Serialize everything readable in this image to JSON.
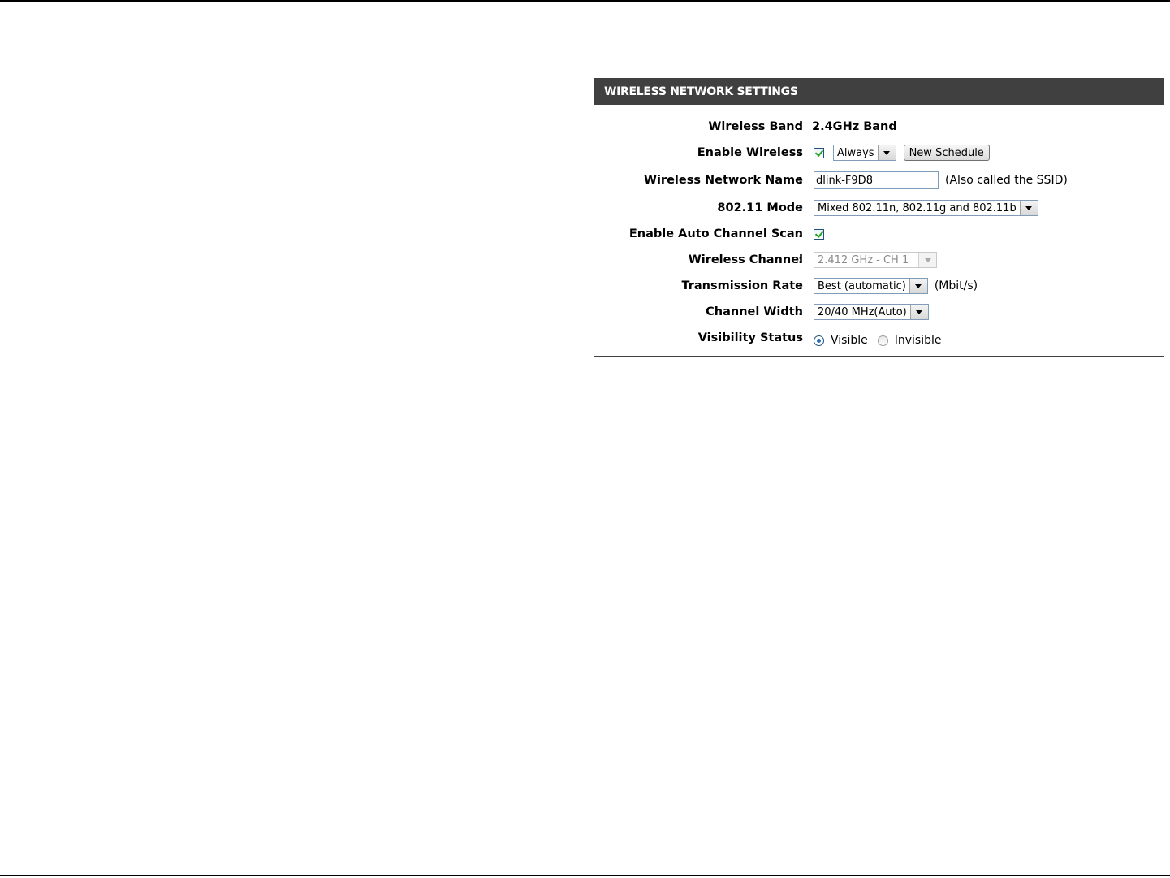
{
  "panel": {
    "title": "WIRELESS NETWORK SETTINGS"
  },
  "rows": {
    "wireless_band": {
      "label": "Wireless Band",
      "colon": ":",
      "value": "2.4GHz Band"
    },
    "enable_wireless": {
      "label": "Enable Wireless",
      "colon": ":",
      "checked": true,
      "schedule_value": "Always",
      "new_schedule_label": "New Schedule"
    },
    "network_name": {
      "label": "Wireless Network Name",
      "colon": ":",
      "value": "dlink-F9D8",
      "note": "(Also called the SSID)"
    },
    "mode": {
      "label": "802.11 Mode",
      "colon": ":",
      "value": "Mixed 802.11n, 802.11g and 802.11b"
    },
    "auto_channel": {
      "label": "Enable Auto Channel Scan",
      "colon": ":",
      "checked": true
    },
    "wireless_channel": {
      "label": "Wireless Channel",
      "colon": ":",
      "value": "2.412 GHz - CH 1",
      "disabled": true
    },
    "transmission_rate": {
      "label": "Transmission Rate",
      "colon": ":",
      "value": "Best (automatic)",
      "unit": "(Mbit/s)"
    },
    "channel_width": {
      "label": "Channel Width",
      "colon": ":",
      "value": "20/40 MHz(Auto)"
    },
    "visibility": {
      "label": "Visibility Status",
      "colon": ":",
      "options": [
        "Visible",
        "Invisible"
      ],
      "selected": "Visible"
    }
  },
  "colors": {
    "header_bg": "#404040",
    "header_text": "#ffffff",
    "border": "#404040",
    "checkmark": "#21a121"
  }
}
